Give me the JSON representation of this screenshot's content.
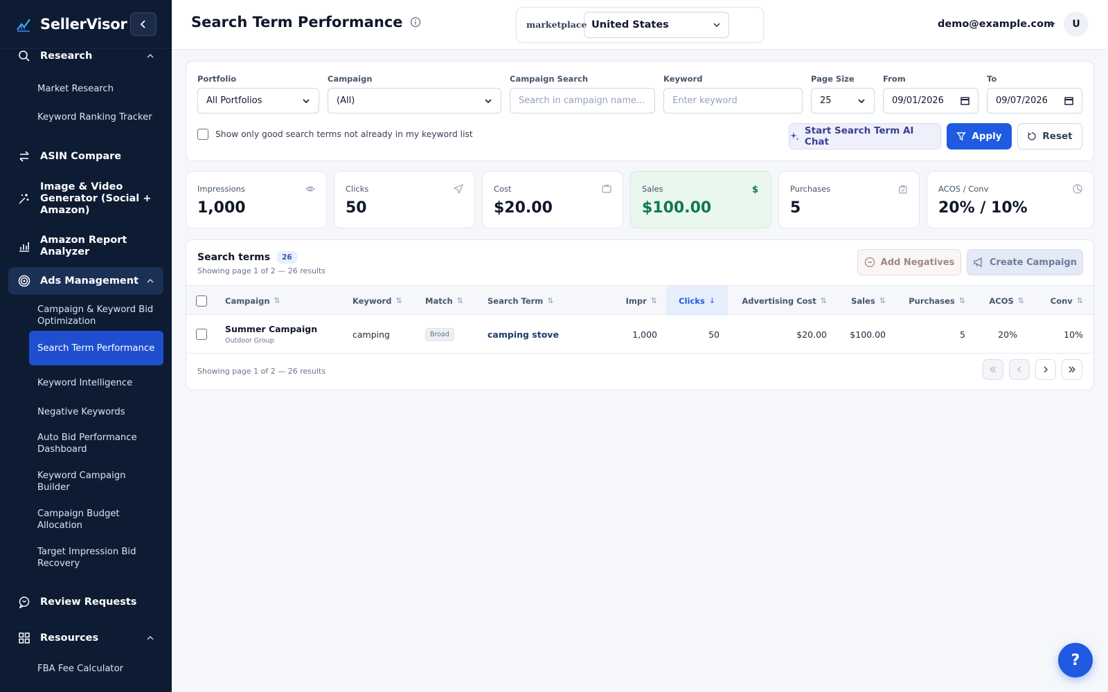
{
  "brand": {
    "name": "SellerVisor"
  },
  "sidebar": {
    "sections": [
      {
        "label": "Research",
        "icon": "search-icon"
      },
      {
        "label": "ASIN Compare",
        "icon": "swap-icon"
      },
      {
        "label": "Image & Video Generator (Social + Amazon)",
        "icon": "sparkle-icon"
      },
      {
        "label": "Amazon Report Analyzer",
        "icon": "bar-chart-icon"
      },
      {
        "label": "Ads Management",
        "icon": "target-icon"
      },
      {
        "label": "Review Requests",
        "icon": "message-icon"
      },
      {
        "label": "Resources",
        "icon": "grid-icon"
      }
    ],
    "research_items": [
      "Market Research",
      "Keyword Ranking Tracker"
    ],
    "ads_items": [
      "Campaign & Keyword Bid Optimization",
      "Search Term Performance",
      "Keyword Intelligence",
      "Negative Keywords",
      "Auto Bid Performance Dashboard",
      "Keyword Campaign Builder",
      "Campaign Budget Allocation",
      "Target Impression Bid Recovery"
    ],
    "resources_items": [
      "FBA Fee Calculator"
    ]
  },
  "header": {
    "title": "Search Term Performance",
    "marketplace_label": "marketplace",
    "marketplace_value": "United States",
    "user_email": "demo@example.com",
    "avatar_initial": "U"
  },
  "filters": {
    "portfolio_label": "Portfolio",
    "portfolio_value": "All Portfolios",
    "campaign_label": "Campaign",
    "campaign_value": "(All)",
    "campaign_search_label": "Campaign Search",
    "campaign_search_placeholder": "Search in campaign name...",
    "keyword_label": "Keyword",
    "keyword_placeholder": "Enter keyword",
    "page_size_label": "Page Size",
    "page_size_value": "25",
    "from_label": "From",
    "from_value": "09/01/2026",
    "to_label": "To",
    "to_value": "09/07/2026",
    "checkbox_label": "Show only good search terms not already in my keyword list",
    "ai_chat_label": "Start Search Term AI Chat",
    "apply_label": "Apply",
    "reset_label": "Reset"
  },
  "metrics": [
    {
      "label": "Impressions",
      "value": "1,000",
      "icon": "eye-icon"
    },
    {
      "label": "Clicks",
      "value": "50",
      "icon": "send-icon"
    },
    {
      "label": "Cost",
      "value": "$20.00",
      "icon": "wallet-icon"
    },
    {
      "label": "Sales",
      "value": "$100.00",
      "icon": "dollar-icon"
    },
    {
      "label": "Purchases",
      "value": "5",
      "icon": "bag-icon"
    },
    {
      "label": "ACOS / Conv",
      "value": "20% / 10%",
      "icon": "pie-icon"
    }
  ],
  "table": {
    "title": "Search terms",
    "count": "26",
    "subtitle": "Showing page 1 of 2 — 26 results",
    "add_negatives_label": "Add Negatives",
    "create_campaign_label": "Create Campaign",
    "columns": [
      "Campaign",
      "Keyword",
      "Match",
      "Search Term",
      "Impr",
      "Clicks",
      "Advertising Cost",
      "Sales",
      "Purchases",
      "ACOS",
      "Conv"
    ],
    "rows": [
      {
        "campaign": "Summer Campaign",
        "group": "Outdoor Group",
        "keyword": "camping",
        "match": "Broad",
        "search_term": "camping stove",
        "impr": "1,000",
        "clicks": "50",
        "cost": "$20.00",
        "sales": "$100.00",
        "purchases": "5",
        "acos": "20%",
        "conv": "10%"
      }
    ],
    "footer": "Showing page 1 of 2 — 26 results"
  },
  "help_label": "?"
}
